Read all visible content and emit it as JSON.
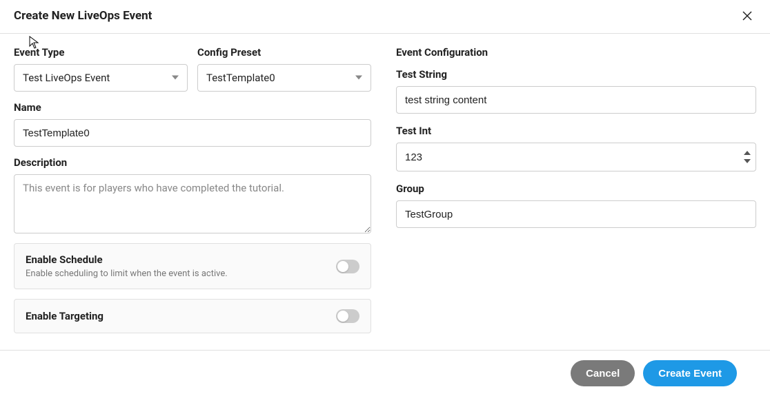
{
  "header": {
    "title": "Create New LiveOps Event"
  },
  "left": {
    "event_type": {
      "label": "Event Type",
      "value": "Test LiveOps Event"
    },
    "config_preset": {
      "label": "Config Preset",
      "value": "TestTemplate0"
    },
    "name": {
      "label": "Name",
      "value": "TestTemplate0"
    },
    "description": {
      "label": "Description",
      "placeholder": "This event is for players who have completed the tutorial."
    },
    "schedule": {
      "title": "Enable Schedule",
      "subtitle": "Enable scheduling to limit when the event is active."
    },
    "targeting": {
      "title": "Enable Targeting"
    }
  },
  "right": {
    "heading": "Event Configuration",
    "test_string": {
      "label": "Test String",
      "value": "test string content"
    },
    "test_int": {
      "label": "Test Int",
      "value": "123"
    },
    "group": {
      "label": "Group",
      "value": "TestGroup"
    }
  },
  "footer": {
    "cancel": "Cancel",
    "create": "Create Event"
  }
}
